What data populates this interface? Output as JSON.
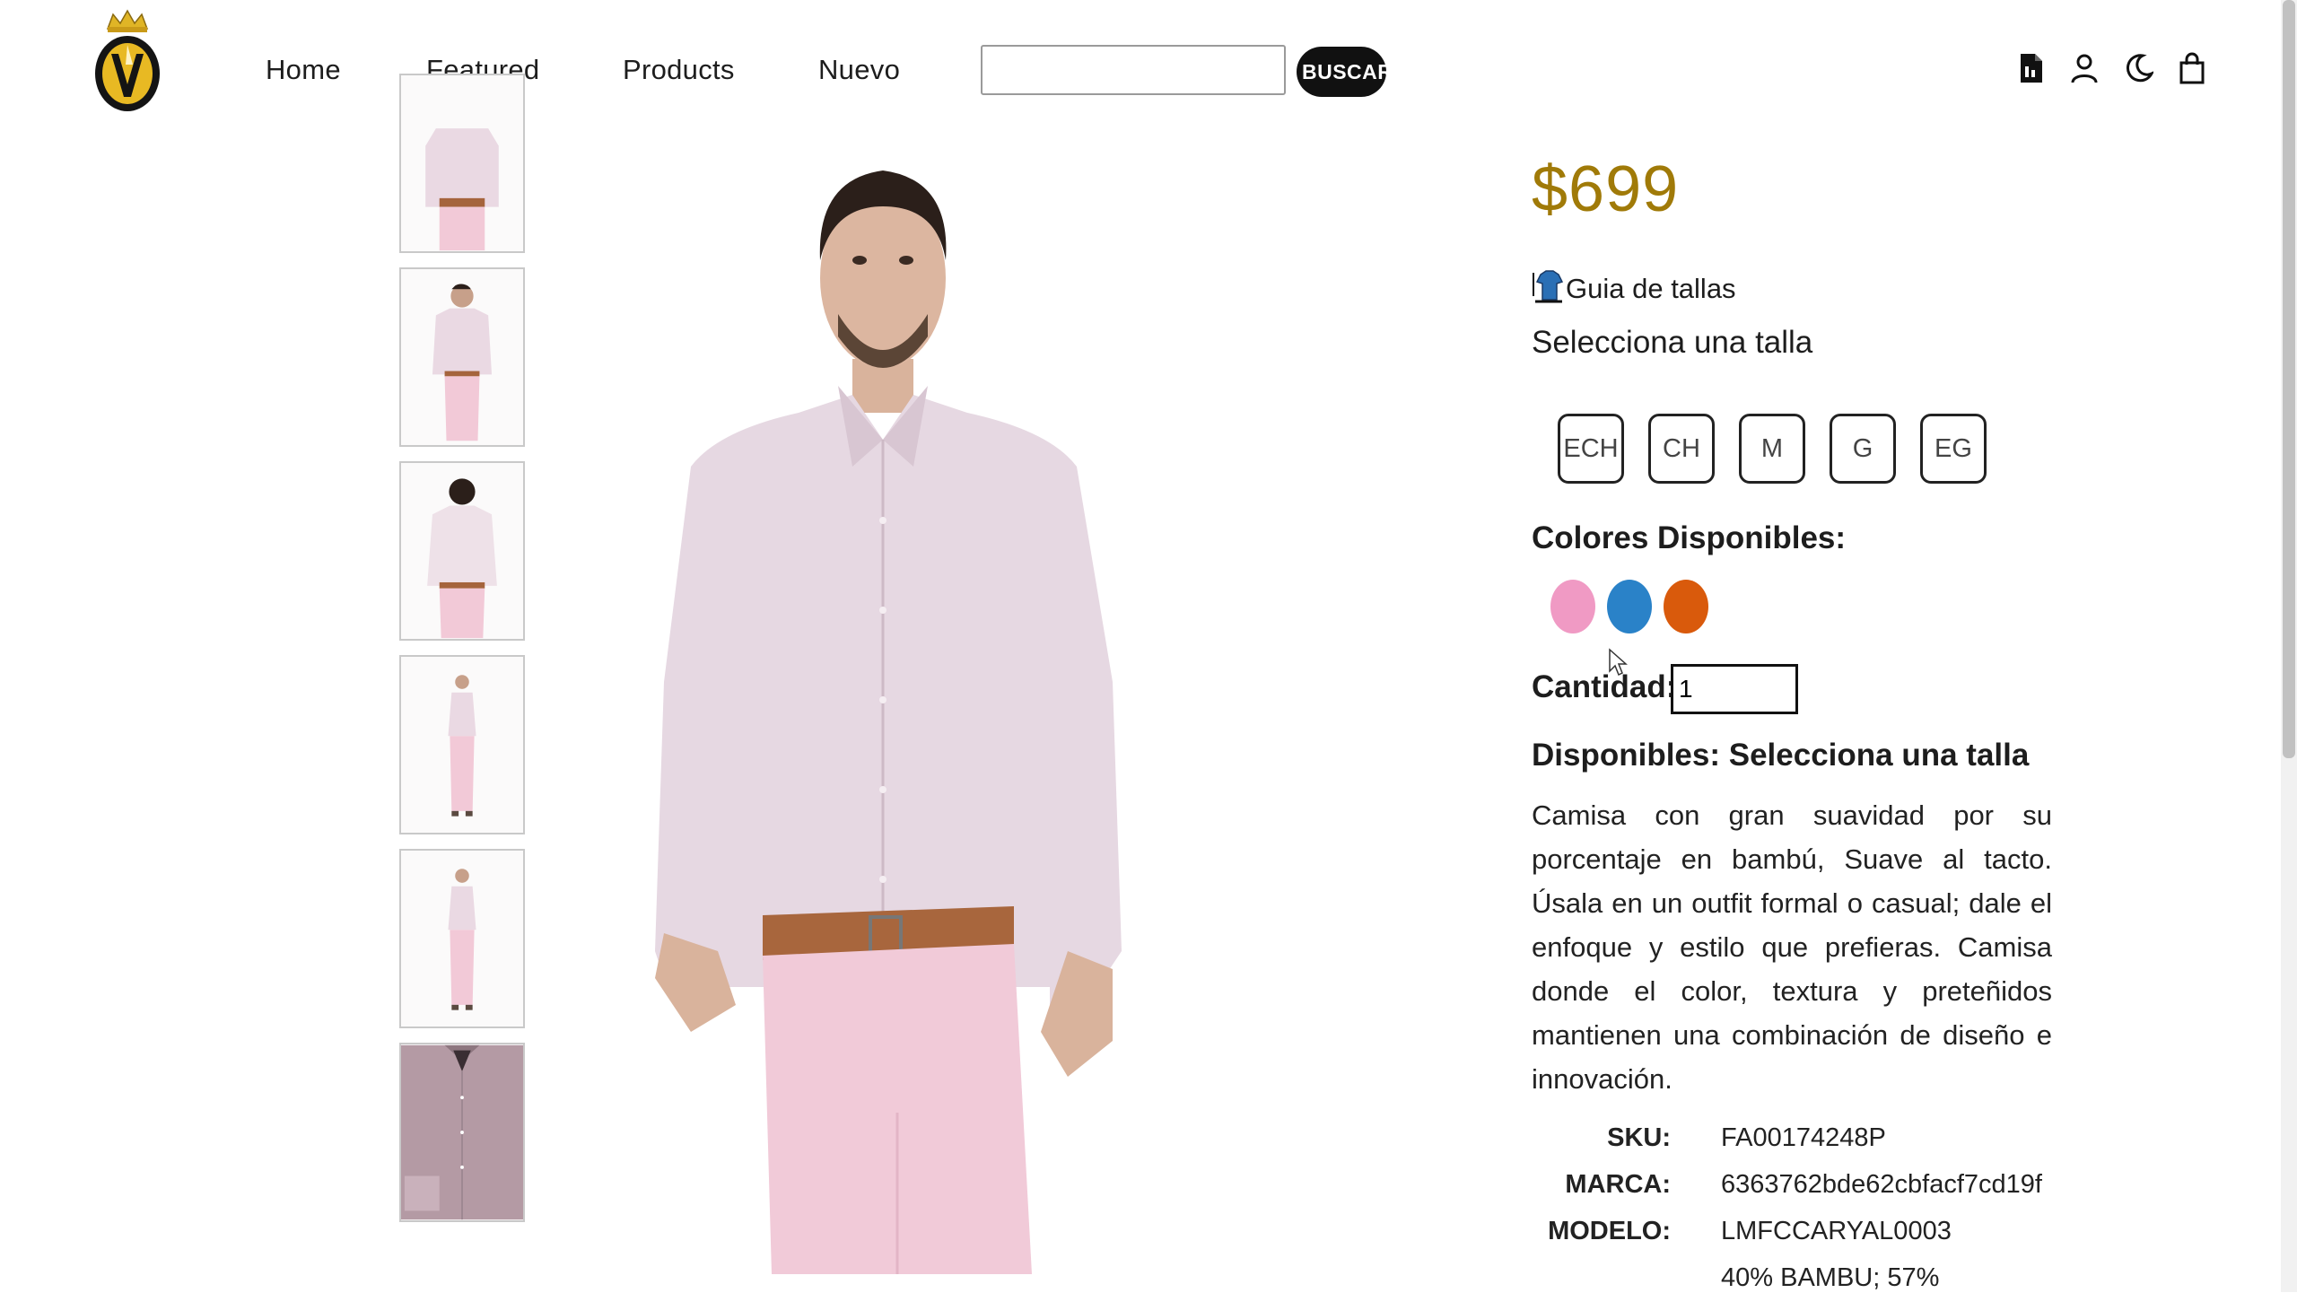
{
  "header": {
    "nav": [
      "Home",
      "Featured",
      "Products",
      "Nuevo"
    ],
    "search": {
      "value": "",
      "button_label": "BUSCAR"
    },
    "icons": [
      "document-icon",
      "user-icon",
      "moon-icon",
      "bag-icon"
    ]
  },
  "product": {
    "price": "$699",
    "size_guide_label": "Guia de tallas",
    "select_size_label": "Selecciona una talla",
    "sizes": [
      "ECH",
      "CH",
      "M",
      "G",
      "EG"
    ],
    "colors_label": "Colores Disponibles:",
    "colors": [
      "#f09ac4",
      "#2a82c8",
      "#d95a0c"
    ],
    "quantity_label": "Cantidad:",
    "quantity_value": "1",
    "available_label": "Disponibles: Selecciona una talla",
    "description": "Camisa con gran suavidad por su porcentaje en bambú, Suave al tacto. Úsala en un outfit formal o casual; dale el enfoque y estilo que prefieras. Camisa donde el color, textura y preteñidos mantienen una combinación de diseño e innovación.",
    "specs": {
      "sku_label": "SKU:",
      "sku": "FA00174248P",
      "brand_label": "MARCA:",
      "brand": "6363762bde62cbfacf7cd19f",
      "model_label": "MODELO:",
      "model": "LMFCCARYAL0003",
      "composition_value": "40% BAMBU; 57%"
    }
  }
}
